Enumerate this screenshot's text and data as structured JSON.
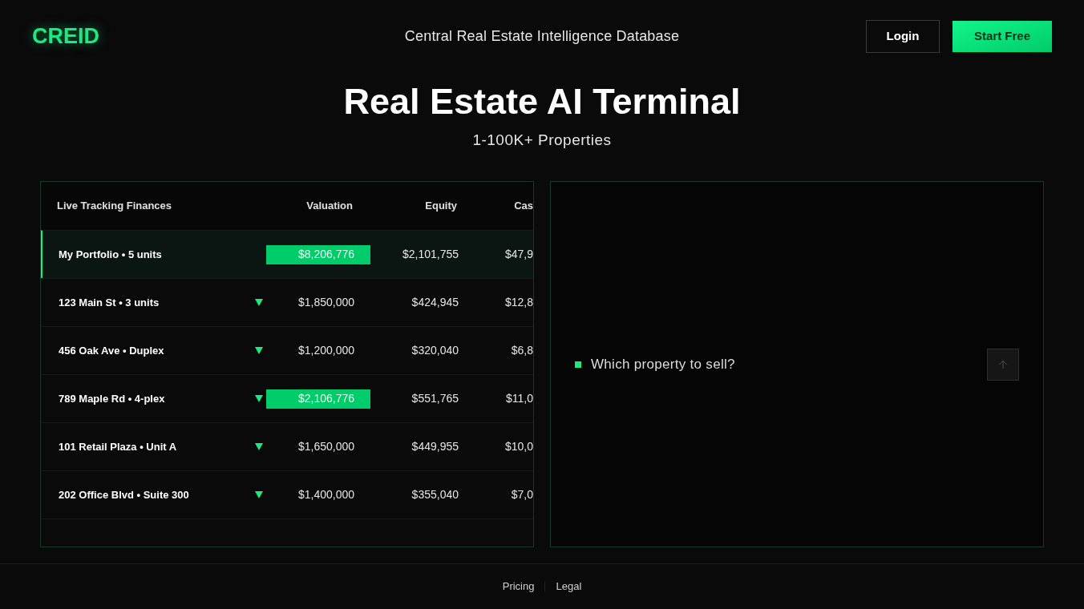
{
  "header": {
    "logo": "CREID",
    "title": "Central Real Estate Intelligence Database",
    "buttons": [
      {
        "label": "Login",
        "kind": "outline"
      },
      {
        "label": "Start Free",
        "kind": "primary"
      }
    ]
  },
  "hero": {
    "title": "Real Estate AI Terminal",
    "subtitle": "1-100K+ Properties"
  },
  "table": {
    "columns": [
      "Live Tracking Finances",
      "Valuation",
      "Equity",
      "Cas"
    ],
    "rows": [
      {
        "name": "My Portfolio • 5 units",
        "selected": true,
        "expandable": false,
        "valuation": "$8,206,776",
        "valuation_highlighted": true,
        "equity": "$2,101,755",
        "column_4": "$47,9"
      },
      {
        "name": "123 Main St • 3 units",
        "selected": false,
        "expandable": true,
        "valuation": "$1,850,000",
        "valuation_highlighted": false,
        "equity": "$424,945",
        "column_4": "$12,8"
      },
      {
        "name": "456 Oak Ave • Duplex",
        "selected": false,
        "expandable": true,
        "valuation": "$1,200,000",
        "valuation_highlighted": false,
        "equity": "$320,040",
        "column_4": "$6,8"
      },
      {
        "name": "789 Maple Rd • 4-plex",
        "selected": false,
        "expandable": true,
        "valuation": "$2,106,776",
        "valuation_highlighted": true,
        "equity": "$551,765",
        "column_4": "$11,0"
      },
      {
        "name": "101 Retail Plaza • Unit A",
        "selected": false,
        "expandable": true,
        "valuation": "$1,650,000",
        "valuation_highlighted": false,
        "equity": "$449,955",
        "column_4": "$10,0"
      },
      {
        "name": "202 Office Blvd • Suite 300",
        "selected": false,
        "expandable": true,
        "valuation": "$1,400,000",
        "valuation_highlighted": false,
        "equity": "$355,040",
        "column_4": "$7,0"
      }
    ]
  },
  "chat": {
    "placeholder": "Which property to sell?"
  },
  "footer": {
    "links": [
      "Pricing",
      "Legal"
    ]
  }
}
